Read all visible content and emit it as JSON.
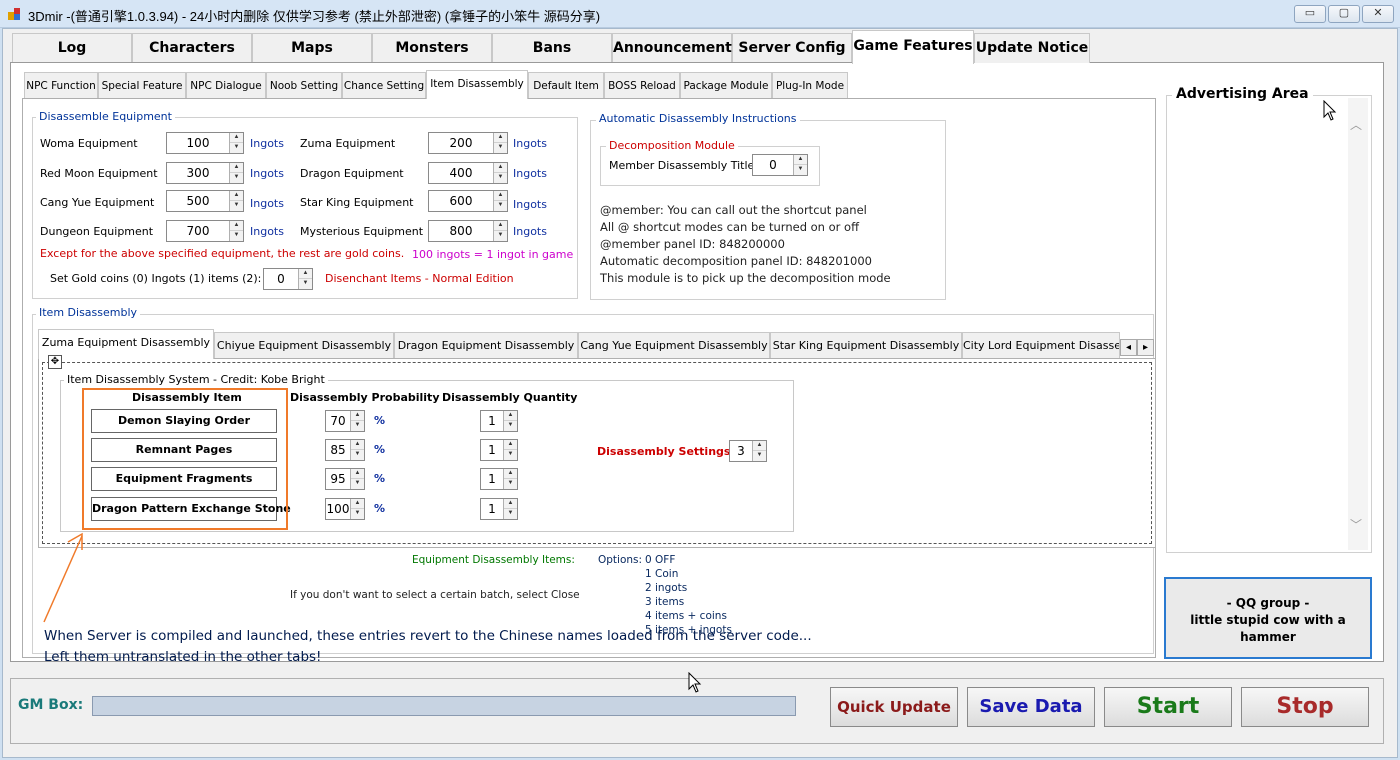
{
  "window": {
    "title": "3Dmir -(普通引擎1.0.3.94) - 24小时内删除  仅供学习参考 (禁止外部泄密) (拿锤子的小笨牛 源码分享)",
    "controls": {
      "minimize": "▭",
      "maximize": "▢",
      "close": "✕"
    }
  },
  "top_tabs": [
    "Log",
    "Characters",
    "Maps",
    "Monsters",
    "Bans",
    "Announcements",
    "Server Config",
    "Game Features",
    "Update Notice"
  ],
  "sub_tabs": [
    "NPC Function",
    "Special Feature",
    "NPC Dialogue",
    "Noob Setting",
    "Chance Setting",
    "Item Disassembly",
    "Default Item",
    "BOSS Reload",
    "Package Module",
    "Plug-In Mode"
  ],
  "disassemble_equipment": {
    "title": "Disassemble Equipment",
    "unit": "Ingots",
    "rows": [
      {
        "label": "Woma Equipment",
        "value": "100"
      },
      {
        "label": "Red Moon Equipment",
        "value": "300"
      },
      {
        "label": "Cang Yue Equipment",
        "value": "500"
      },
      {
        "label": "Dungeon Equipment",
        "value": "700"
      },
      {
        "label": "Zuma Equipment",
        "value": "200"
      },
      {
        "label": "Dragon Equipment",
        "value": "400"
      },
      {
        "label": "Star King Equipment",
        "value": "600"
      },
      {
        "label": "Mysterious Equipment",
        "value": "800"
      }
    ],
    "except_note": "Except for the above specified equipment, the rest are gold coins.",
    "ingot_note": "100 ingots = 1 ingot in game",
    "set_label": "Set Gold coins (0) Ingots (1) items (2):",
    "set_value": "0",
    "disenchant_note": "Disenchant Items - Normal Edition"
  },
  "auto_instructions": {
    "title": "Automatic Disassembly Instructions",
    "module_title": "Decomposition Module",
    "member_label": "Member Disassembly Title",
    "member_value": "0",
    "lines": [
      "@member: You can call out the shortcut panel",
      "All @ shortcut modes can be turned on or off",
      "@member panel ID: 848200000",
      "Automatic decomposition panel ID: 848201000",
      "This module is to pick up the decomposition mode"
    ]
  },
  "item_disassembly": {
    "title": "Item Disassembly",
    "tabs": [
      "Zuma Equipment Disassembly",
      "Chiyue Equipment Disassembly",
      "Dragon Equipment Disassembly",
      "Cang Yue Equipment Disassembly",
      "Star King Equipment Disassembly",
      "City Lord Equipment Disasse"
    ],
    "scroll_left": "◂",
    "scroll_right": "▸",
    "system_title": "Item Disassembly System - Credit: Kobe Bright",
    "col_item": "Disassembly Item",
    "col_prob": "Disassembly Probability",
    "col_qty": "Disassembly Quantity",
    "percent": "%",
    "rows": [
      {
        "item": "Demon Slaying Order",
        "prob": "70",
        "qty": "1"
      },
      {
        "item": "Remnant Pages",
        "prob": "85",
        "qty": "1"
      },
      {
        "item": "Equipment Fragments",
        "prob": "95",
        "qty": "1"
      },
      {
        "item": "Dragon Pattern Exchange Stone",
        "prob": "100",
        "qty": "1"
      }
    ],
    "settings_label": "Disassembly Settings:",
    "settings_value": "3",
    "equip_items_label": "Equipment Disassembly Items:",
    "options_label": "Options:",
    "options": [
      "0 OFF",
      "1 Coin",
      "2 ingots",
      "3 items",
      "4 items + coins",
      "5 items + ingots"
    ],
    "batch_note": "If you don't want to select a certain batch, select Close"
  },
  "annotation": {
    "line1": "When Server is compiled and launched, these entries revert to the Chinese names loaded from the server code...",
    "line2": "Left them untranslated in the other tabs!"
  },
  "sidebar": {
    "ad_title": "Advertising Area",
    "qq_line1": "- QQ group -",
    "qq_line2": "little stupid cow with a hammer"
  },
  "bottom": {
    "gm_label": "GM Box:",
    "gm_value": "",
    "quick_update": "Quick Update",
    "save_data": "Save Data",
    "start": "Start",
    "stop": "Stop"
  },
  "colors": {
    "accent_orange": "#f07a2a",
    "quick_update": "#8b1a1a",
    "save_data": "#1a1ab0",
    "start": "#1a7a1a",
    "stop": "#a82a2a",
    "gm_label": "#1a7a7a"
  }
}
